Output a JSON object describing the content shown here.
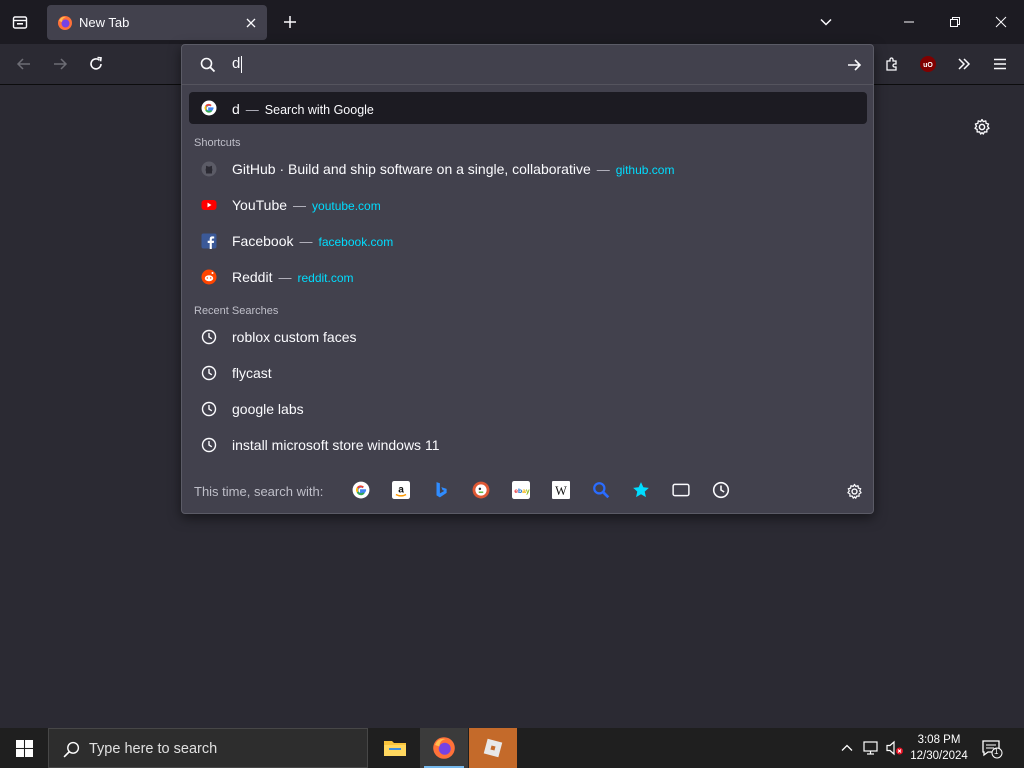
{
  "browser": {
    "tab": {
      "title": "New Tab"
    },
    "urlbar": {
      "typed": "d",
      "heuristic": {
        "query": "d",
        "action": "Search with Google"
      },
      "groups": {
        "shortcuts_label": "Shortcuts",
        "recent_label": "Recent Searches"
      },
      "shortcuts": [
        {
          "title": "GitHub · Build and ship software on a single, collaborative",
          "url": "github.com",
          "icon": "github-icon"
        },
        {
          "title": "YouTube",
          "url": "youtube.com",
          "icon": "youtube-icon"
        },
        {
          "title": "Facebook",
          "url": "facebook.com",
          "icon": "facebook-icon"
        },
        {
          "title": "Reddit",
          "url": "reddit.com",
          "icon": "reddit-icon"
        }
      ],
      "recent": [
        "roblox custom faces",
        "flycast",
        "google labs",
        "install microsoft store windows 11"
      ],
      "footer_label": "This time, search with:",
      "separator": "—"
    }
  },
  "taskbar": {
    "search_placeholder": "Type here to search",
    "time": "3:08 PM",
    "date": "12/30/2024",
    "notification_count": "1"
  },
  "colors": {
    "tab_bg": "#42414d",
    "panel_bg": "#42414d",
    "url_accent": "#00ddff",
    "page_bg": "#2b2a33"
  }
}
